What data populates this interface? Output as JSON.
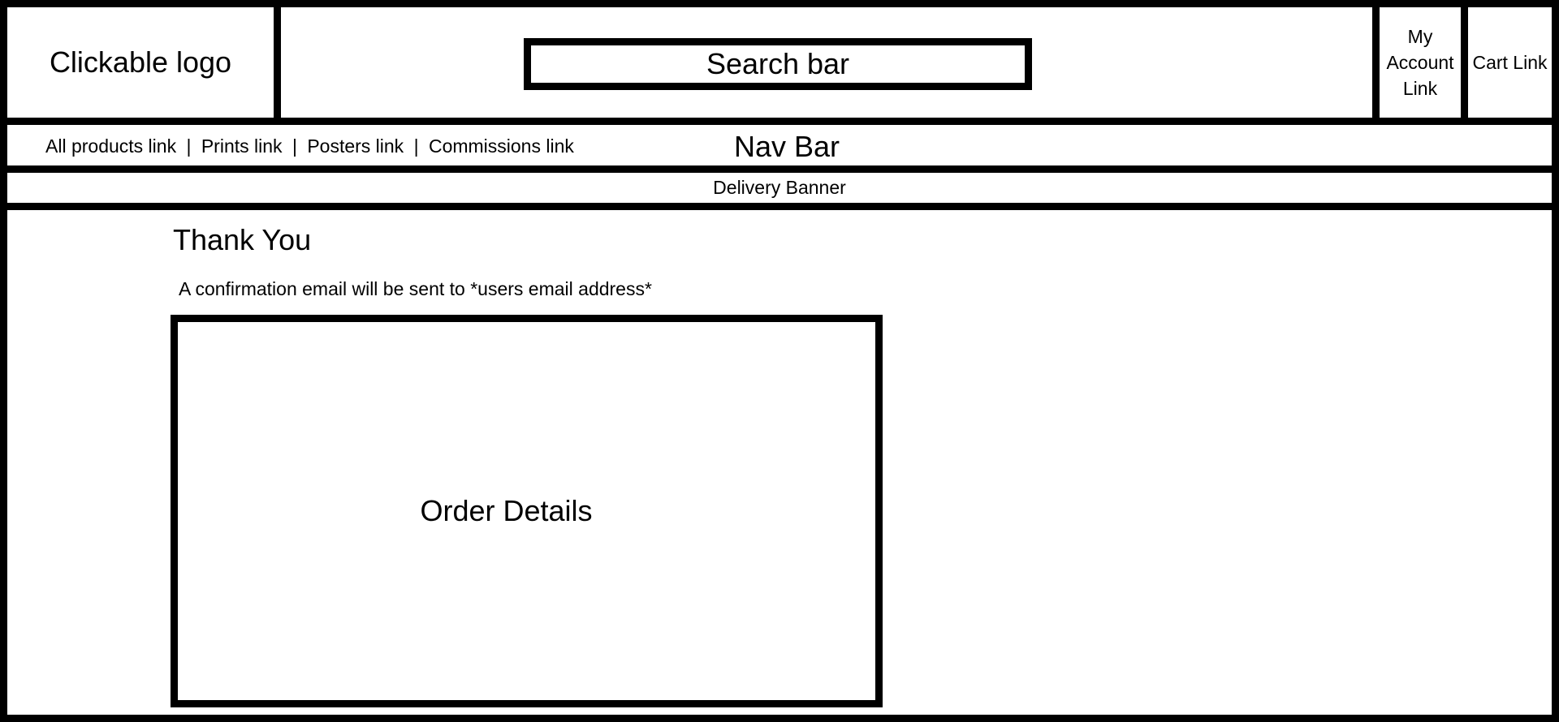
{
  "header": {
    "logo_label": "Clickable logo",
    "search_label": "Search bar",
    "account_link": "My Account Link",
    "cart_link": "Cart Link"
  },
  "nav": {
    "title": "Nav Bar",
    "links": [
      "All products link",
      "Prints link",
      "Posters link",
      "Commissions link"
    ],
    "separator": "|"
  },
  "banner": {
    "label": "Delivery Banner"
  },
  "main": {
    "title": "Thank You",
    "confirmation": "A confirmation email will be sent to *users email address*",
    "order_details_label": "Order Details"
  },
  "colors": {
    "border": "#000000",
    "background": "#ffffff"
  }
}
